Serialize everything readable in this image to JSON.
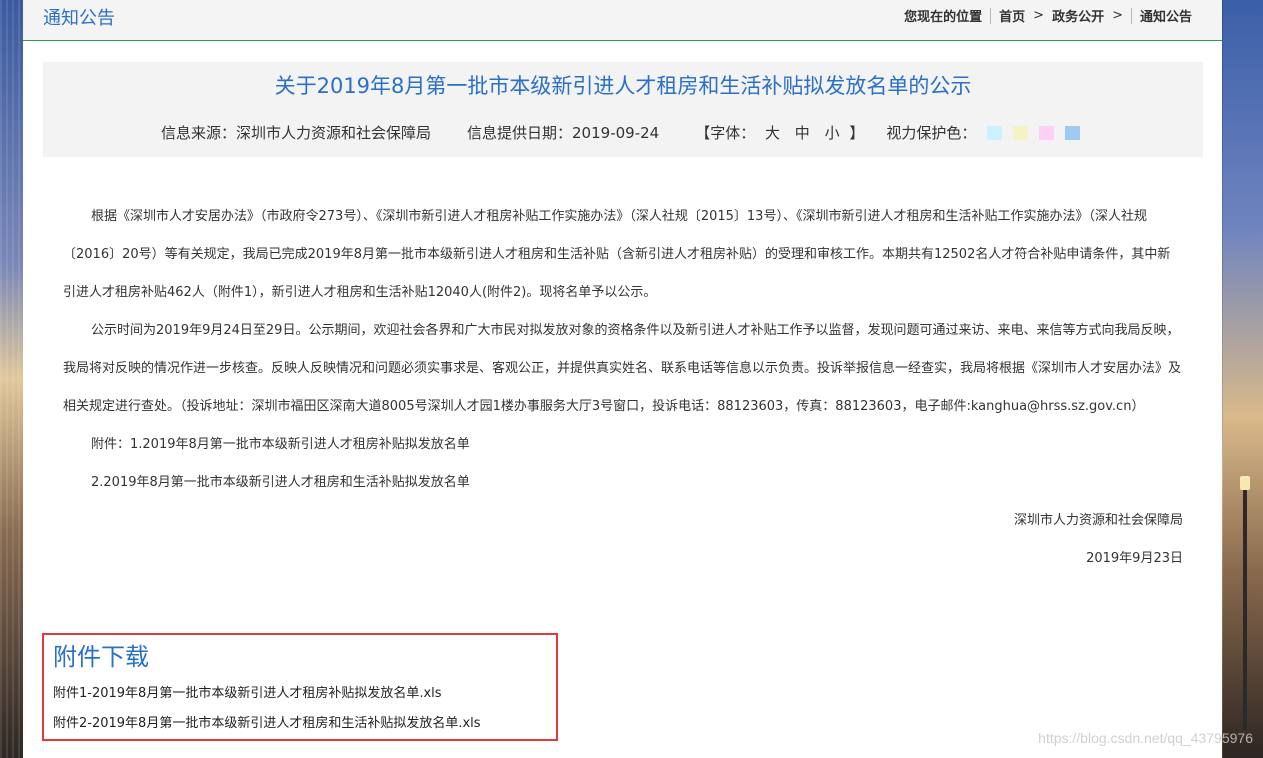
{
  "header": {
    "section_title": "通知公告",
    "breadcrumb": {
      "location_label": "您现在的位置",
      "items": [
        "首页",
        "政务公开",
        "通知公告"
      ],
      "separator": ">"
    }
  },
  "article": {
    "title": "关于2019年8月第一批市本级新引进人才租房和生活补贴拟发放名单的公示",
    "meta": {
      "source": "信息来源：深圳市人力资源和社会保障局",
      "date": "信息提供日期：2019-09-24",
      "font_label_open": "【字体：",
      "font_large": "大",
      "font_medium": "中",
      "font_small": "小",
      "font_label_close": "】",
      "eye_care_label": "视力保护色：",
      "eye_care_colors": [
        "#ccf0ff",
        "#f6f3c2",
        "#ffd0f6",
        "#9ecbf4"
      ]
    },
    "body": {
      "para1": "根据《深圳市人才安居办法》（市政府令273号）、《深圳市新引进人才租房补贴工作实施办法》（深人社规〔2015〕13号）、《深圳市新引进人才租房和生活补贴工作实施办法》（深人社规〔2016〕20号）等有关规定，我局已完成2019年8月第一批市本级新引进人才租房和生活补贴（含新引进人才租房补贴）的受理和审核工作。本期共有12502名人才符合补贴申请条件，其中新引进人才租房补贴462人（附件1），新引进人才租房和生活补贴12040人(附件2)。现将名单予以公示。",
      "para2": "公示时间为2019年9月24日至29日。公示期间，欢迎社会各界和广大市民对拟发放对象的资格条件以及新引进人才补贴工作予以监督，发现问题可通过来访、来电、来信等方式向我局反映，我局将对反映的情况作进一步核查。反映人反映情况和问题必须实事求是、客观公正，并提供真实姓名、联系电话等信息以示负责。投诉举报信息一经查实，我局将根据《深圳市人才安居办法》及相关规定进行查处。（投诉地址：深圳市福田区深南大道8005号深圳人才园1楼办事服务大厅3号窗口，投诉电话：88123603，传真：88123603，电子邮件:kanghua@hrss.sz.gov.cn）",
      "attachment_line1": "附件：1.2019年8月第一批市本级新引进人才租房补贴拟发放名单",
      "attachment_line2": "2.2019年8月第一批市本级新引进人才租房和生活补贴拟发放名单",
      "signature": "深圳市人力资源和社会保障局",
      "sign_date": "2019年9月23日"
    }
  },
  "downloads": {
    "title": "附件下载",
    "files": [
      "附件1-2019年8月第一批市本级新引进人才租房补贴拟发放名单.xls",
      "附件2-2019年8月第一批市本级新引进人才租房和生活补贴拟发放名单.xls"
    ]
  },
  "watermark": "https://blog.csdn.net/qq_43795976"
}
